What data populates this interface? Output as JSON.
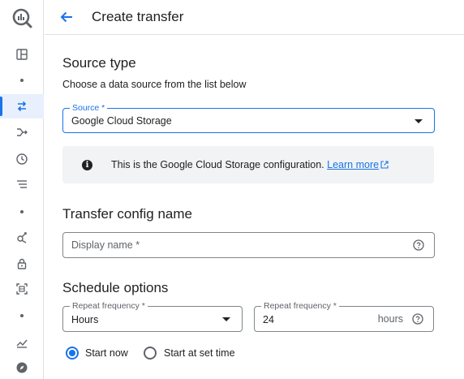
{
  "header": {
    "title": "Create transfer",
    "back_icon": "arrow-back-icon"
  },
  "rail": {
    "logo_icon": "bigquery-logo-icon",
    "items": [
      {
        "icon": "dashboard-icon"
      },
      {
        "icon": "swap-arrows-icon",
        "active": true
      },
      {
        "icon": "pipeline-icon"
      },
      {
        "icon": "history-clock-icon"
      },
      {
        "icon": "list-icon"
      },
      {
        "icon": "wrench-icon"
      },
      {
        "icon": "lock-icon"
      },
      {
        "icon": "scan-frame-icon"
      },
      {
        "icon": "analytics-icon"
      },
      {
        "icon": "compass-icon"
      }
    ],
    "accent_color": "#1a73e8"
  },
  "source": {
    "section_title": "Source type",
    "subtitle": "Choose a data source from the list below",
    "label": "Source *",
    "value": "Google Cloud Storage"
  },
  "info": {
    "text": "This is the Google Cloud Storage configuration.",
    "link_text": "Learn more"
  },
  "config_name": {
    "section_title": "Transfer config name",
    "placeholder": "Display name *"
  },
  "schedule": {
    "section_title": "Schedule options",
    "repeat_label": "Repeat frequency *",
    "repeat_value": "Hours",
    "frequency_label": "Repeat frequency *",
    "frequency_value": "24",
    "frequency_unit": "hours",
    "radio_start_now": "Start now",
    "radio_start_at": "Start at set time",
    "selected": "Start now"
  }
}
